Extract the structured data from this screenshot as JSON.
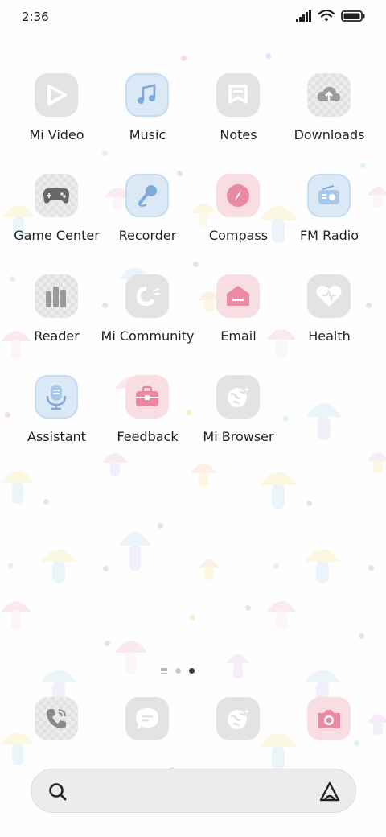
{
  "status_bar": {
    "time": "2:36"
  },
  "apps": [
    {
      "label": "Mi Video",
      "icon": "play-icon"
    },
    {
      "label": "Music",
      "icon": "music-note-icon"
    },
    {
      "label": "Notes",
      "icon": "bookmark-note-icon"
    },
    {
      "label": "Downloads",
      "icon": "cloud-download-icon"
    },
    {
      "label": "Game Center",
      "icon": "gamepad-icon"
    },
    {
      "label": "Recorder",
      "icon": "microphone-icon"
    },
    {
      "label": "Compass",
      "icon": "compass-icon"
    },
    {
      "label": "FM Radio",
      "icon": "radio-icon"
    },
    {
      "label": "Reader",
      "icon": "books-icon"
    },
    {
      "label": "Mi Community",
      "icon": "bird-icon"
    },
    {
      "label": "Email",
      "icon": "mail-icon"
    },
    {
      "label": "Health",
      "icon": "heart-icon"
    },
    {
      "label": "Assistant",
      "icon": "assistant-mic-icon"
    },
    {
      "label": "Feedback",
      "icon": "toolbox-icon"
    },
    {
      "label": "Mi Browser",
      "icon": "globe-icon"
    }
  ],
  "page_indicator": {
    "pages": 2,
    "active": 2
  },
  "dock": [
    {
      "icon": "phone-icon"
    },
    {
      "icon": "message-icon"
    },
    {
      "icon": "browser-globe-icon"
    },
    {
      "icon": "camera-icon"
    }
  ],
  "search": {
    "left_icon": "search-icon",
    "right_icon": "assistant-logo-icon"
  }
}
